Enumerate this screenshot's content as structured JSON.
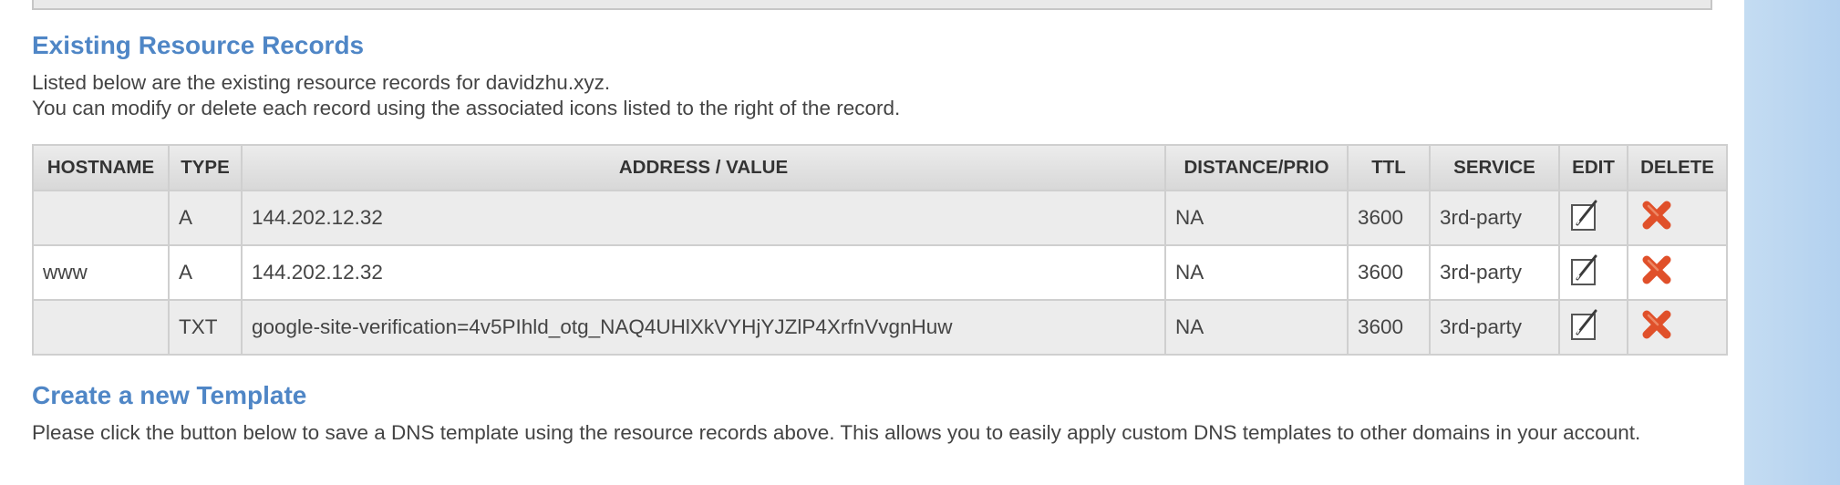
{
  "existing_records": {
    "title": "Existing Resource Records",
    "description_line1": "Listed below are the existing resource records for davidzhu.xyz.",
    "description_line2": "You can modify or delete each record using the associated icons listed to the right of the record.",
    "columns": [
      "HOSTNAME",
      "TYPE",
      "ADDRESS / VALUE",
      "DISTANCE/PRIO",
      "TTL",
      "SERVICE",
      "EDIT",
      "DELETE"
    ],
    "rows": [
      {
        "hostname": "",
        "type": "A",
        "value": "144.202.12.32",
        "prio": "NA",
        "ttl": "3600",
        "service": "3rd-party"
      },
      {
        "hostname": "www",
        "type": "A",
        "value": "144.202.12.32",
        "prio": "NA",
        "ttl": "3600",
        "service": "3rd-party"
      },
      {
        "hostname": "",
        "type": "TXT",
        "value": "google-site-verification=4v5PIhld_otg_NAQ4UHlXkVYHjYJZlP4XrfnVvgnHuw",
        "prio": "NA",
        "ttl": "3600",
        "service": "3rd-party"
      }
    ],
    "edit_icon": "pencil-edit-icon",
    "delete_icon": "red-x-delete-icon",
    "delete_color": "#e0502a"
  },
  "create_template": {
    "title": "Create a new Template",
    "description": "Please click the button below to save a DNS template using the resource records above. This allows you to easily apply custom DNS templates to other domains in your account."
  },
  "colors": {
    "heading": "#4f86c6",
    "text": "#444444",
    "right_background": "#b3d1ef"
  }
}
